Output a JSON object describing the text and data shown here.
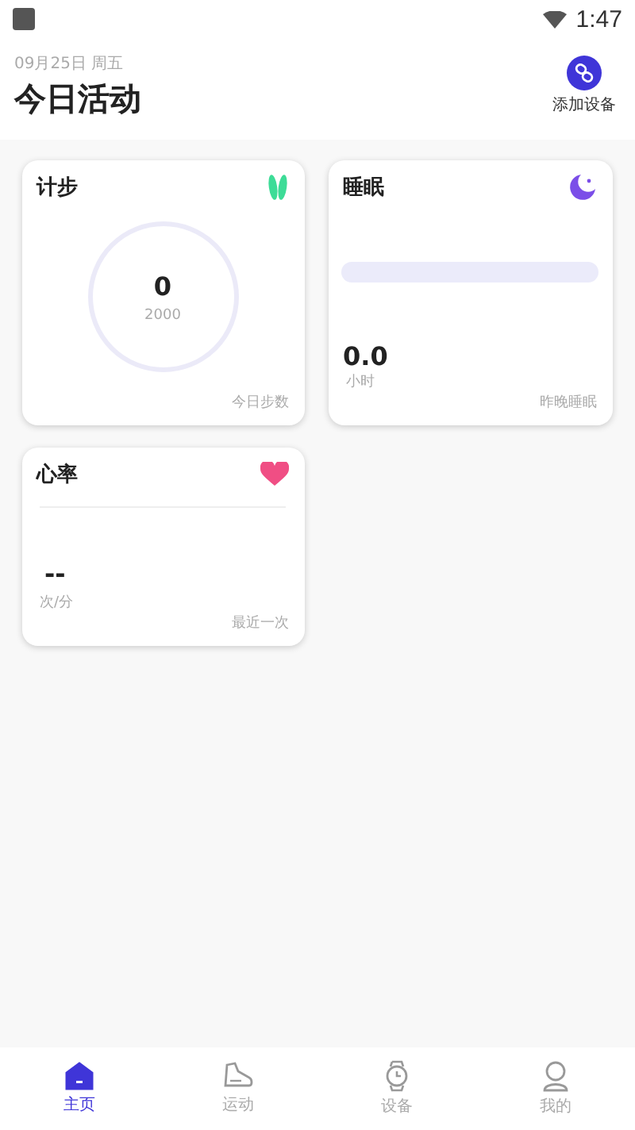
{
  "status_bar": {
    "time": "1:47"
  },
  "header": {
    "date": "09月25日 周五",
    "title": "今日活动",
    "add_device": "添加设备"
  },
  "cards": [
    {
      "kind": "steps",
      "title": "计步",
      "value": "0",
      "goal": "2000",
      "footer": "今日步数"
    },
    {
      "kind": "sleep",
      "title": "睡眠",
      "value": "0.0",
      "unit": "小时",
      "footer": "昨晚睡眠"
    },
    {
      "kind": "heart",
      "title": "心率",
      "value": "--",
      "unit": "次/分",
      "footer": "最近一次"
    }
  ],
  "nav": [
    {
      "kind": "home",
      "label": "主页",
      "selected": true
    },
    {
      "kind": "sport",
      "label": "运动",
      "selected": false
    },
    {
      "kind": "device",
      "label": "设备",
      "selected": false
    },
    {
      "kind": "me",
      "label": "我的",
      "selected": false
    }
  ]
}
